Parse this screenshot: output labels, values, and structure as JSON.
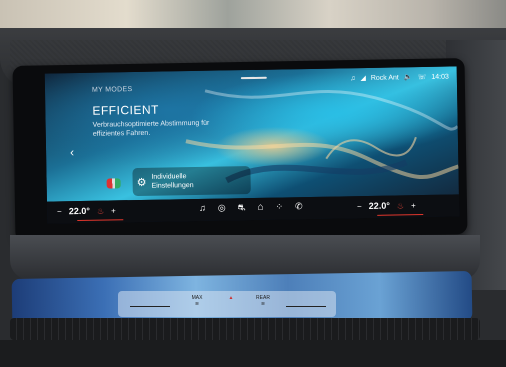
{
  "screen": {
    "section_label": "MY MODES",
    "mode_title": "EFFICIENT",
    "mode_description": "Verbrauchsoptimierte Abstimmung für effizientes Fahren.",
    "settings_label_line1": "Individuelle",
    "settings_label_line2": "Einstellungen",
    "prev_glyph": "‹",
    "status": {
      "media": "Rock Ant",
      "time": "14:03"
    },
    "climate_left": {
      "minus": "−",
      "temp": "22.0°",
      "plus": "+"
    },
    "climate_right": {
      "minus": "−",
      "temp": "22.0°",
      "plus": "+"
    },
    "nav_icons": [
      "music-icon",
      "navigation-icon",
      "car-icon",
      "home-icon",
      "apps-icon",
      "phone-icon"
    ]
  },
  "center_panel": {
    "max_label": "MAX",
    "rear_label": "REAR"
  },
  "colors": {
    "accent_red": "#e0362c",
    "screen_blue": "#39c1e0",
    "ambient_blue": "#3b6fb5"
  }
}
